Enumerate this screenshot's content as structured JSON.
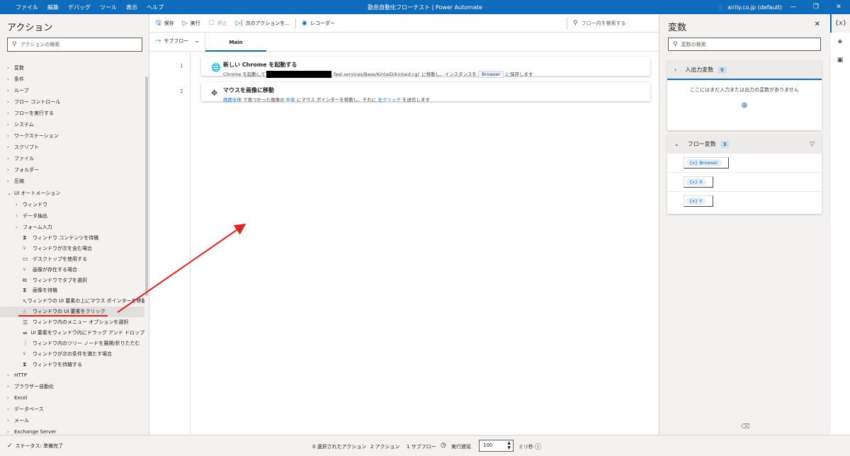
{
  "titlebar": {
    "menus": [
      "ファイル",
      "編集",
      "デバッグ",
      "ツール",
      "表示",
      "ヘルプ"
    ],
    "title": "勤怠自動化フローテスト | Power Automate",
    "account": "airily.co.jp (default)"
  },
  "actions_panel": {
    "title": "アクション",
    "search_placeholder": "アクションの検索",
    "tree": [
      {
        "label": "変数",
        "level": 0,
        "icon": "chevron-right-icon"
      },
      {
        "label": "条件",
        "level": 0,
        "icon": "chevron-right-icon"
      },
      {
        "label": "ループ",
        "level": 0,
        "icon": "chevron-right-icon"
      },
      {
        "label": "フロー コントロール",
        "level": 0,
        "icon": "chevron-right-icon"
      },
      {
        "label": "フローを実行する",
        "level": 0,
        "icon": "chevron-right-icon"
      },
      {
        "label": "システム",
        "level": 0,
        "icon": "chevron-right-icon"
      },
      {
        "label": "ワークステーション",
        "level": 0,
        "icon": "chevron-right-icon"
      },
      {
        "label": "スクリプト",
        "level": 0,
        "icon": "chevron-right-icon"
      },
      {
        "label": "ファイル",
        "level": 0,
        "icon": "chevron-right-icon"
      },
      {
        "label": "フォルダー",
        "level": 0,
        "icon": "chevron-right-icon"
      },
      {
        "label": "圧縮",
        "level": 0,
        "icon": "chevron-right-icon"
      },
      {
        "label": "UI オートメーション",
        "level": 0,
        "icon": "chevron-down-icon"
      },
      {
        "label": "ウィンドウ",
        "level": 1,
        "icon": "chevron-right-icon"
      },
      {
        "label": "データ抽出",
        "level": 1,
        "icon": "chevron-right-icon"
      },
      {
        "label": "フォーム入力",
        "level": 1,
        "icon": "chevron-right-icon"
      },
      {
        "label": "ウィンドウ コンテンツを待機",
        "level": 2,
        "icon": "hourglass-icon"
      },
      {
        "label": "ウィンドウが次を含む場合",
        "level": 2,
        "icon": "branch-icon"
      },
      {
        "label": "デスクトップを使用する",
        "level": 2,
        "icon": "monitor-icon"
      },
      {
        "label": "画像が存在する場合",
        "level": 2,
        "icon": "branch-icon"
      },
      {
        "label": "ウィンドウでタブを選択",
        "level": 2,
        "icon": "tab-icon"
      },
      {
        "label": "画像を待機",
        "level": 2,
        "icon": "hourglass-icon"
      },
      {
        "label": "ウィンドウの UI 要素の上にマウス ポインターを移動...",
        "level": 2,
        "icon": "pointer-icon"
      },
      {
        "label": "ウィンドウの UI 要素をクリック",
        "level": 2,
        "icon": "click-icon",
        "selected": true
      },
      {
        "label": "ウィンドウ内のメニュー オプションを選択",
        "level": 2,
        "icon": "menu-icon"
      },
      {
        "label": "UI 要素をウィンドウ内にドラッグ アンド ドロップ",
        "level": 2,
        "icon": "drag-icon"
      },
      {
        "label": "ウィンドウ内のツリー ノードを展開/折りたたむ",
        "level": 2,
        "icon": "tree-icon"
      },
      {
        "label": "ウィンドウが次の条件を満たす場合",
        "level": 2,
        "icon": "branch-icon"
      },
      {
        "label": "ウィンドウを待機する",
        "level": 2,
        "icon": "hourglass-icon"
      },
      {
        "label": "HTTP",
        "level": 0,
        "icon": "chevron-right-icon"
      },
      {
        "label": "ブラウザー自動化",
        "level": 0,
        "icon": "chevron-right-icon"
      },
      {
        "label": "Excel",
        "level": 0,
        "icon": "chevron-right-icon"
      },
      {
        "label": "データベース",
        "level": 0,
        "icon": "chevron-right-icon"
      },
      {
        "label": "メール",
        "level": 0,
        "icon": "chevron-right-icon"
      },
      {
        "label": "Exchange Server",
        "level": 0,
        "icon": "chevron-right-icon"
      }
    ]
  },
  "toolbar": {
    "save": "保存",
    "run": "実行",
    "stop": "停止",
    "next": "次のアクションを...",
    "recorder": "レコーダー",
    "search_placeholder": "フロー内を検索する"
  },
  "tabs": {
    "subflow": "サブフロー",
    "main": "Main"
  },
  "steps": [
    {
      "num": "1",
      "title": "新しい Chrome を起動する",
      "desc_a": "Chrome を起動して",
      "desc_url": ".feel.services/Base/KintaiD/kintaid.cgi",
      "desc_b": "' に移動し、インスタンスを ",
      "desc_var": "Browser",
      "desc_c": " に保存します"
    },
    {
      "num": "2",
      "title": "マウスを画像に移動",
      "d1": "画面全体",
      "d2": " で見つかった画像の ",
      "d3": "中央",
      "d4": " にマウス ポインターを移動し、それに ",
      "d5": "左クリック",
      "d6": " を送信します"
    }
  ],
  "variables_panel": {
    "title": "変数",
    "search_placeholder": "変数の検索",
    "io_title": "入出力変数",
    "io_count": "0",
    "io_empty": "ここにはまだ入力または出力の変数がありません",
    "flow_title": "フロー変数",
    "flow_count": "3",
    "flow_vars": [
      "Browser",
      "X",
      "Y"
    ]
  },
  "statusbar": {
    "status": "ステータス: 準備完了",
    "selected": "0 選択されたアクション",
    "actions": "2 アクション",
    "subflows": "1 サブフロー",
    "delay_label": "実行遅延",
    "delay_value": "100",
    "delay_unit": "ミリ秒"
  },
  "colors": {
    "accent": "#0f6cbd",
    "annotation": "#e8211d"
  }
}
